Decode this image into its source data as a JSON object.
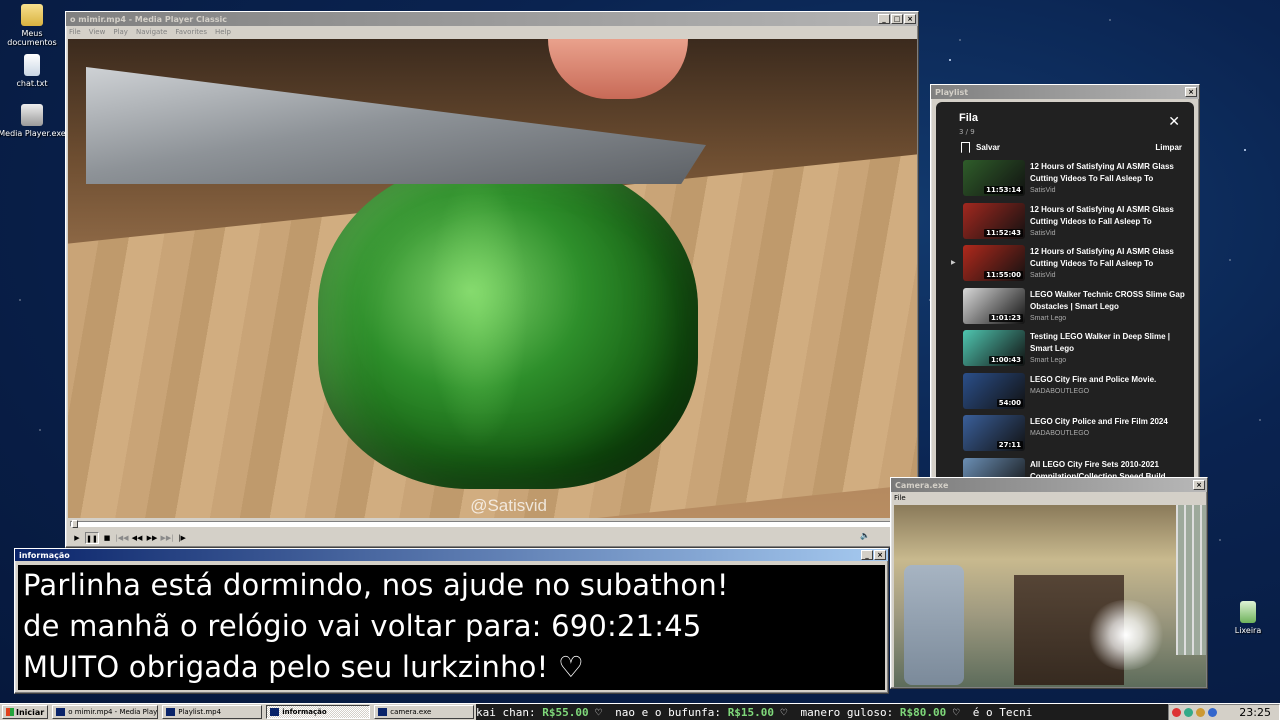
{
  "desktop": {
    "icons": [
      {
        "label": "Meus documentos",
        "icon": "folder-icon",
        "color": "#f0d36a"
      },
      {
        "label": "chat.txt",
        "icon": "text-file-icon",
        "color": "#e6ecf2"
      },
      {
        "label": "Media Player.exe",
        "icon": "media-player-icon",
        "color": "#d9d9d9"
      },
      {
        "label": "Lixeira",
        "icon": "recycle-bin-icon",
        "color": "#9fd48e"
      }
    ]
  },
  "media_player": {
    "title": "o mimir.mp4 - Media Player Classic",
    "menu": [
      "File",
      "View",
      "Play",
      "Navigate",
      "Favorites",
      "Help"
    ],
    "watermark": "@Satisvid",
    "controls": [
      "▶",
      "❚❚",
      "■",
      "|◀◀",
      "◀◀",
      "▶▶",
      "▶▶|",
      "|▶"
    ]
  },
  "info_window": {
    "title": "informação",
    "lines": [
      "Parlinha está dormindo, nos ajude no subathon!",
      "de manhã o relógio vai voltar para:  690:21:45",
      "MUITO obrigada pelo seu lurkzinho! ♡"
    ]
  },
  "playlist_window": {
    "title": "Playlist",
    "header": "Fila",
    "count": "3 / 9",
    "save_label": "Salvar",
    "clear_label": "Limpar",
    "items": [
      {
        "title": "12 Hours of Satisfying AI ASMR Glass Cutting Videos To Fall Asleep To",
        "channel": "SatisVid",
        "duration": "11:53:14",
        "thumb_color": "#2f5d2a",
        "current": false
      },
      {
        "title": "12 Hours of Satisfying AI ASMR Glass Cutting Videos to Fall Asleep To",
        "channel": "SatisVid",
        "duration": "11:52:43",
        "thumb_color": "#a2281f",
        "current": false
      },
      {
        "title": "12 Hours of Satisfying AI ASMR Glass Cutting Videos To Fall Asleep To",
        "channel": "SatisVid",
        "duration": "11:55:00",
        "thumb_color": "#b0291c",
        "current": true
      },
      {
        "title": "LEGO Walker Technic CROSS Slime Gap Obstacles | Smart Lego",
        "channel": "Smart Lego",
        "duration": "1:01:23",
        "thumb_color": "#d9d9d9",
        "current": false
      },
      {
        "title": "Testing LEGO Walker in Deep Slime | Smart Lego",
        "channel": "Smart Lego",
        "duration": "1:00:43",
        "thumb_color": "#4fc6b0",
        "current": false
      },
      {
        "title": "LEGO City Fire and Police Movie.",
        "channel": "MADABOUTLEGO",
        "duration": "54:00",
        "thumb_color": "#2b4f8a",
        "current": false
      },
      {
        "title": "LEGO City Police and Fire Film 2024",
        "channel": "MADABOUTLEGO",
        "duration": "27:11",
        "thumb_color": "#3a5f9a",
        "current": false
      },
      {
        "title": "All LEGO City Fire Sets 2010-2021 Compilation/Collection Speed Build",
        "channel": "",
        "duration": "",
        "thumb_color": "#6b8fb5",
        "current": false
      }
    ]
  },
  "camera_window": {
    "title": "Camera.exe",
    "menu": [
      "File"
    ]
  },
  "taskbar": {
    "start_label": "Iniciar",
    "tasks": [
      {
        "label": "o mimir.mp4 - Media Playe...",
        "active": false
      },
      {
        "label": "Playlist.mp4",
        "active": false
      },
      {
        "label": "informação",
        "active": true
      },
      {
        "label": "camera.exe",
        "active": false
      }
    ],
    "ticker": [
      {
        "text": "kai chan: ",
        "amount": "R$55.00",
        "end": " ♡  "
      },
      {
        "text": "nao e o bufunfa: ",
        "amount": "R$15.00",
        "end": " ♡  "
      },
      {
        "text": "manero guloso: ",
        "amount": "R$80.00",
        "end": " ♡  "
      },
      {
        "text": "é o Tecni",
        "amount": "",
        "end": ""
      }
    ],
    "clock": "23:25"
  },
  "colors": {
    "active_title": "#0a246a",
    "inactive_title": "#808080",
    "playlist_bg": "#212121",
    "ticker_amount": "#7fd87a"
  }
}
